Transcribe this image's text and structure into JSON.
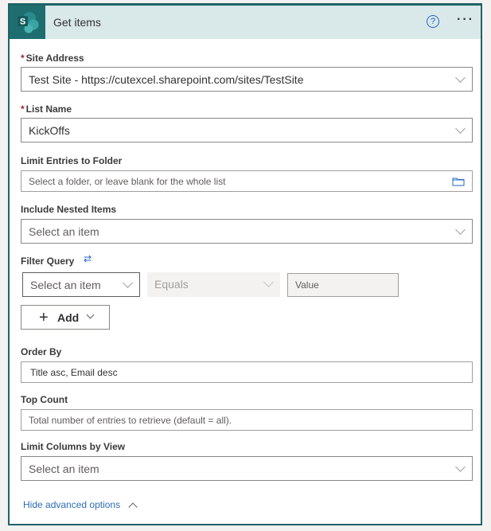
{
  "header": {
    "title": "Get items",
    "help_icon": "question-circle-icon",
    "more_icon": "ellipsis-icon",
    "more_label": "···"
  },
  "fields": {
    "site_address": {
      "label": "Site Address",
      "required": "*",
      "value": "Test Site - https://cutexcel.sharepoint.com/sites/TestSite"
    },
    "list_name": {
      "label": "List Name",
      "required": "*",
      "value": "KickOffs"
    },
    "limit_folder": {
      "label": "Limit Entries to Folder",
      "placeholder": "Select a folder, or leave blank for the whole list"
    },
    "nested_items": {
      "label": "Include Nested Items",
      "placeholder": "Select an item"
    },
    "filter_query": {
      "label": "Filter Query",
      "swap_icon": "⇄",
      "field_placeholder": "Select an item",
      "operator": "Equals",
      "value_placeholder": "Value",
      "add_label": "Add",
      "add_plus": "+"
    },
    "order_by": {
      "label": "Order By",
      "value": "Title asc, Email desc"
    },
    "top_count": {
      "label": "Top Count",
      "placeholder": "Total number of entries to retrieve (default = all)."
    },
    "limit_columns": {
      "label": "Limit Columns by View",
      "placeholder": "Select an item"
    }
  },
  "footer": {
    "advanced_link": "Hide advanced options"
  }
}
